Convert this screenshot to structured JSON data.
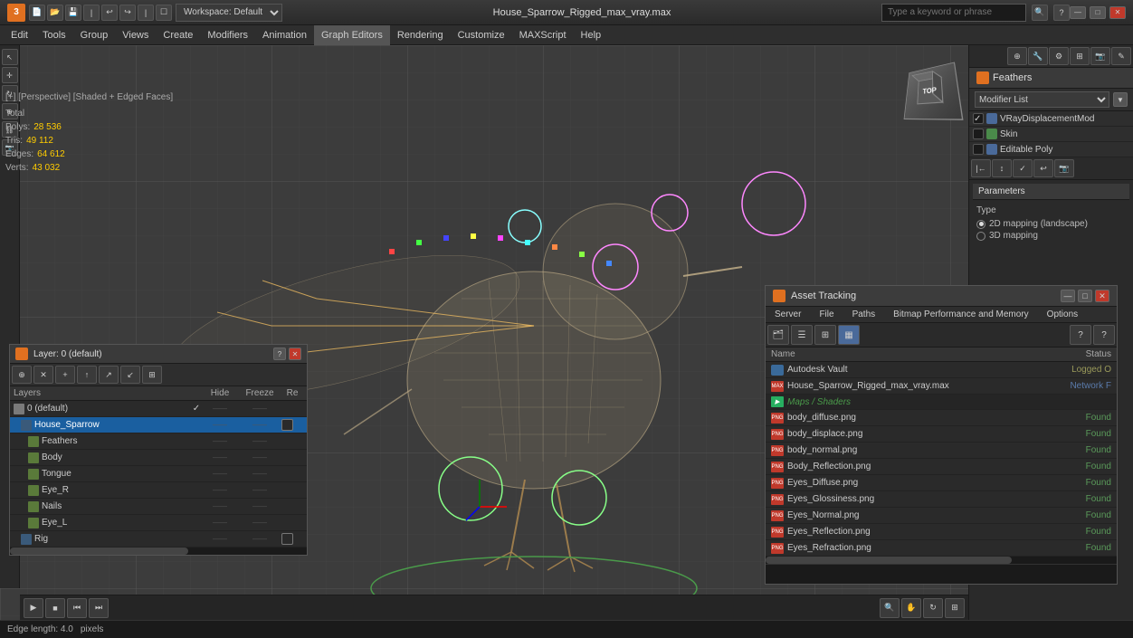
{
  "title_bar": {
    "app_name": "3ds Max",
    "file_name": "House_Sparrow_Rigged_max_vray.max",
    "workspace_label": "Workspace: Default",
    "search_placeholder": "Type a keyword or phrase",
    "min_btn": "—",
    "max_btn": "□",
    "close_btn": "✕"
  },
  "menu": {
    "items": [
      "Edit",
      "Tools",
      "Group",
      "Views",
      "Create",
      "Modifiers",
      "Animation",
      "Graph Editors",
      "Rendering",
      "Customize",
      "MAXScript",
      "Help"
    ]
  },
  "viewport": {
    "label": "[+] [Perspective] [Shaded + Edged Faces]"
  },
  "stats": {
    "label": "Total",
    "polys_label": "Polys:",
    "polys_value": "28 536",
    "tris_label": "Tris:",
    "tris_value": "49 112",
    "edges_label": "Edges:",
    "edges_value": "64 612",
    "verts_label": "Verts:",
    "verts_value": "43 032"
  },
  "right_panel": {
    "feathers_title": "Feathers",
    "modifier_list_label": "Modifier List",
    "modifiers": [
      {
        "name": "VRayDisplacementMod",
        "type": "blue"
      },
      {
        "name": "Skin",
        "type": "green"
      },
      {
        "name": "Editable Poly",
        "type": "blue"
      }
    ],
    "params_header": "Parameters",
    "params_type_label": "Type",
    "params_options": [
      {
        "label": "2D mapping (landscape)",
        "checked": true
      },
      {
        "label": "3D mapping",
        "checked": false
      }
    ]
  },
  "layer_panel": {
    "title": "Layer: 0 (default)",
    "question_mark": "?",
    "close_btn": "✕",
    "toolbar_btns": [
      "⊕",
      "✕",
      "+",
      "↕",
      "↗",
      "↙",
      "⊞"
    ],
    "columns": {
      "layers": "Layers",
      "hide": "Hide",
      "freeze": "Freeze",
      "re": "Re"
    },
    "rows": [
      {
        "name": "0 (default)",
        "indent": 0,
        "type": "default",
        "checked": true,
        "dots": "——",
        "dots2": "——",
        "re": ""
      },
      {
        "name": "House_Sparrow",
        "indent": 1,
        "type": "selected",
        "checkbox": true,
        "dots": "——",
        "dots2": "——",
        "re": ""
      },
      {
        "name": "Feathers",
        "indent": 2,
        "type": "normal",
        "dots": "——",
        "dots2": "——",
        "re": ""
      },
      {
        "name": "Body",
        "indent": 2,
        "type": "normal",
        "dots": "——",
        "dots2": "——",
        "re": ""
      },
      {
        "name": "Tongue",
        "indent": 2,
        "type": "normal",
        "dots": "——",
        "dots2": "——",
        "re": ""
      },
      {
        "name": "Eye_R",
        "indent": 2,
        "type": "normal",
        "dots": "——",
        "dots2": "——",
        "re": ""
      },
      {
        "name": "Nails",
        "indent": 2,
        "type": "normal",
        "dots": "——",
        "dots2": "——",
        "re": ""
      },
      {
        "name": "Eye_L",
        "indent": 2,
        "type": "normal",
        "dots": "——",
        "dots2": "——",
        "re": ""
      },
      {
        "name": "Rig",
        "indent": 1,
        "type": "normal",
        "checkbox": true,
        "dots": "——",
        "dots2": "——",
        "re": ""
      }
    ]
  },
  "asset_tracking": {
    "title": "Asset Tracking",
    "menu_items": [
      "Server",
      "File",
      "Paths",
      "Bitmap Performance and Memory",
      "Options"
    ],
    "toolbar_btns": [
      "🗂",
      "☰",
      "⊞",
      "▦"
    ],
    "help_btns": [
      "?",
      "?"
    ],
    "columns": {
      "name": "Name",
      "status": "Status"
    },
    "rows": [
      {
        "name": "Autodesk Vault",
        "type": "vault",
        "status": "Logged O",
        "status_class": "logged"
      },
      {
        "name": "House_Sparrow_Rigged_max_vray.max",
        "type": "max",
        "status": "Network F",
        "status_class": "network"
      },
      {
        "name": "Maps / Shaders",
        "type": "group"
      },
      {
        "name": "body_diffuse.png",
        "type": "png-red",
        "status": "Found",
        "status_class": "found"
      },
      {
        "name": "body_displace.png",
        "type": "png-red",
        "status": "Found",
        "status_class": "found"
      },
      {
        "name": "body_normal.png",
        "type": "png-red",
        "status": "Found",
        "status_class": "found"
      },
      {
        "name": "Body_Reflection.png",
        "type": "png-red",
        "status": "Found",
        "status_class": "found"
      },
      {
        "name": "Eyes_Diffuse.png",
        "type": "png-red",
        "status": "Found",
        "status_class": "found"
      },
      {
        "name": "Eyes_Glossiness.png",
        "type": "png-red",
        "status": "Found",
        "status_class": "found"
      },
      {
        "name": "Eyes_Normal.png",
        "type": "png-red",
        "status": "Found",
        "status_class": "found"
      },
      {
        "name": "Eyes_Reflection.png",
        "type": "png-red",
        "status": "Found",
        "status_class": "found"
      },
      {
        "name": "Eyes_Refraction.png",
        "type": "png-red",
        "status": "Found",
        "status_class": "found"
      }
    ]
  },
  "status_bar": {
    "edge_length_label": "Edge length: 4.0",
    "units": "pixels"
  }
}
